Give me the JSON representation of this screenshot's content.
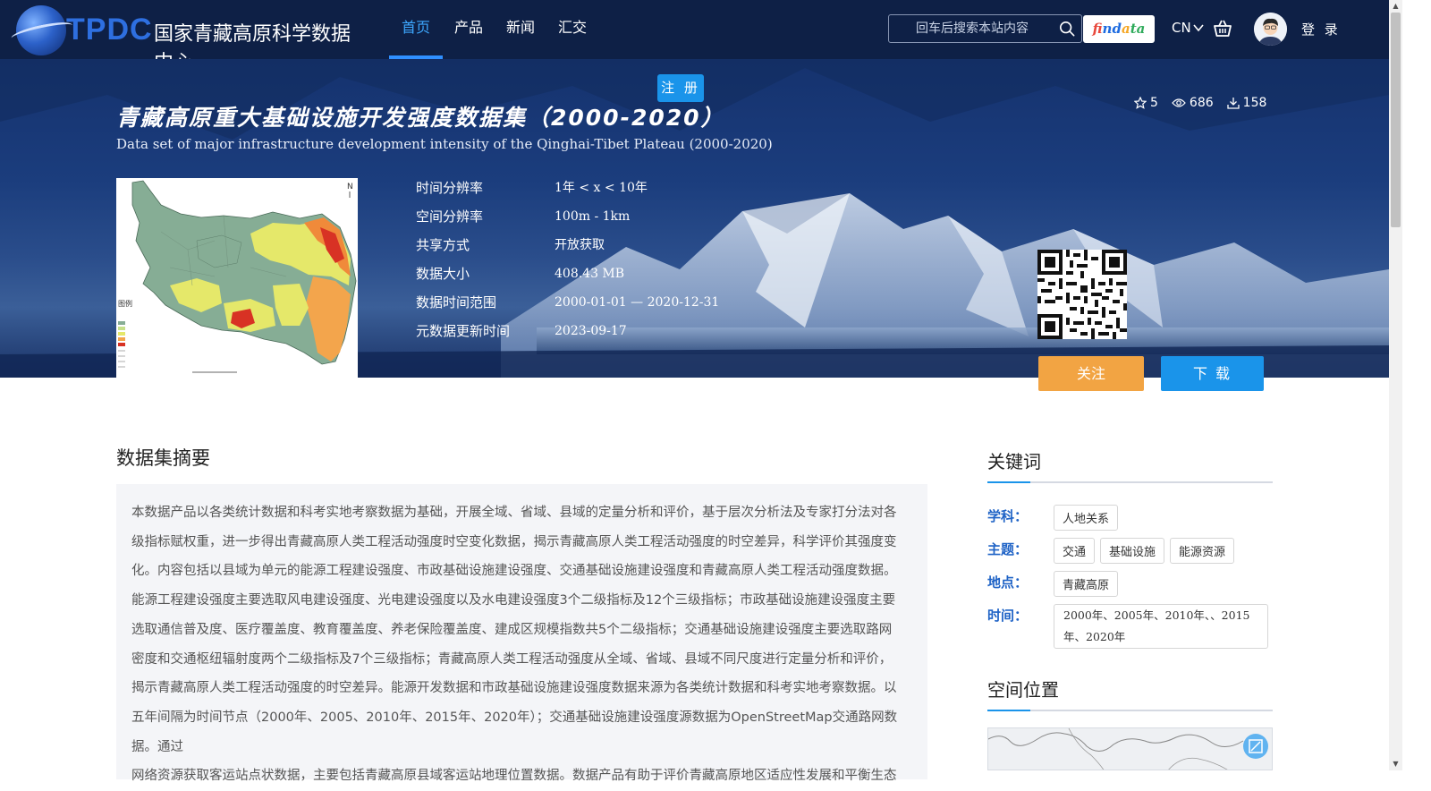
{
  "header": {
    "logo_text": "TPDC",
    "site_name": "国家青藏高原科学数据中心",
    "nav": [
      {
        "label": "首页"
      },
      {
        "label": "产品"
      },
      {
        "label": "新闻"
      },
      {
        "label": "汇交"
      }
    ],
    "search_placeholder": "回车后搜索本站内容",
    "findata": {
      "f1": "fi",
      "f2": "nd",
      "f3": "a",
      "f4": "ta"
    },
    "lang": "CN",
    "login": "登 录"
  },
  "hero": {
    "register": "注 册",
    "title_cn": "青藏高原重大基础设施开发强度数据集（2000-2020）",
    "title_en": "Data set of major infrastructure development intensity of the Qinghai-Tibet Plateau (2000-2020)",
    "stats": {
      "stars": "5",
      "views": "686",
      "downloads": "158"
    },
    "meta": [
      {
        "key": "时间分辨率",
        "value": "1年 < x < 10年"
      },
      {
        "key": "空间分辨率",
        "value": "100m - 1km"
      },
      {
        "key": "共享方式",
        "value": "开放获取"
      },
      {
        "key": "数据大小",
        "value": "408.43 MB"
      },
      {
        "key": "数据时间范围",
        "value": "2000-01-01 — 2020-12-31"
      },
      {
        "key": "元数据更新时间",
        "value": "2023-09-17"
      }
    ],
    "follow": "关注",
    "download": "下 载"
  },
  "abstract": {
    "title": "数据集摘要",
    "lines": [
      "本数据产品以各类统计数据和科考实地考察数据为基础，开展全域、省域、县域的定量分析和评价，基于层次分析法及专家打分法对各",
      "级指标赋权重，进一步得出青藏高原人类工程活动强度时空变化数据，揭示青藏高原人类工程活动强度的时空差异，科学评价其强度变",
      "化。内容包括以县域为单元的能源工程建设强度、市政基础设施建设强度、交通基础设施建设强度和青藏高原人类工程活动强度数据。",
      "能源工程建设强度主要选取风电建设强度、光电建设强度以及水电建设强度3个二级指标及12个三级指标；市政基础设施建设强度主要",
      "选取通信普及度、医疗覆盖度、教育覆盖度、养老保险覆盖度、建成区规模指数共5个二级指标；交通基础设施建设强度主要选取路网",
      "密度和交通枢纽辐射度两个二级指标及7个三级指标；青藏高原人类工程活动强度从全域、省域、县域不同尺度进行定量分析和评价，",
      "揭示青藏高原人类工程活动强度的时空差异。能源开发数据和市政基础设施建设强度数据来源为各类统计数据和科考实地考察数据。以",
      "五年间隔为时间节点（2000年、2005、2010年、2015年、2020年）；交通基础设施建设强度源数据为OpenStreetMap交通路网数据。通过",
      "网络资源获取客运站点状数据，主要包括青藏高原县域客运站地理位置数据。数据产品有助于评价青藏高原地区适应性发展和平衡生态"
    ]
  },
  "sidebar": {
    "keywords_title": "关键词",
    "rows": [
      {
        "label": "学科：",
        "tags": [
          "人地关系"
        ]
      },
      {
        "label": "主题：",
        "tags": [
          "交通",
          "基础设施",
          "能源资源"
        ]
      },
      {
        "label": "地点：",
        "tags": [
          "青藏高原"
        ]
      },
      {
        "label": "时间：",
        "tags": [
          "2000年、2005年、2010年、、2015年、2020年"
        ]
      }
    ],
    "location_title": "空间位置"
  },
  "colors": {
    "nav_bg": "#0e2046",
    "accent_blue": "#1a94ea",
    "follow_orange": "#f2a443",
    "keyword_label": "#1f63c6"
  }
}
